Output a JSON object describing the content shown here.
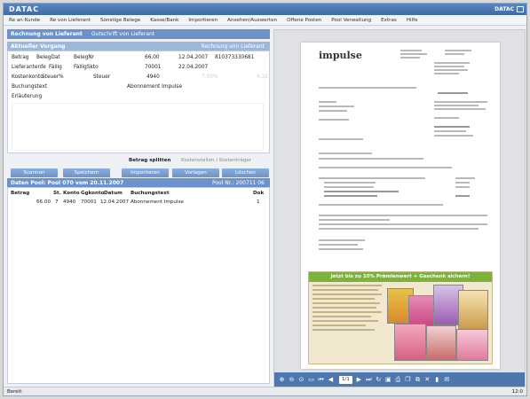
{
  "app": {
    "logo": "DATAC",
    "brand": "DATAC"
  },
  "menu": [
    "Re an Kunde",
    "Re von Lieferant",
    "Sonstige Belege",
    "Kasse/Bank",
    "Importieren",
    "Ansehen/Auswerten",
    "Offene Posten",
    "Pool Verwaltung",
    "Extras",
    "Hilfe"
  ],
  "section": {
    "title": "Rechnung von Lieferant",
    "subtitle": "Gutschrift von Lieferant"
  },
  "form_panel": {
    "title": "Aktueller Vorgang",
    "right": "Rechnung von Lieferant"
  },
  "form": {
    "row1": {
      "label1": "Betrag",
      "label2": "BelegDat",
      "label3": "BelegNr",
      "v1": "66.00",
      "v2": "12.04.2007",
      "v3": "810373330681"
    },
    "row2": {
      "label1": "Lieferantenfe",
      "label2": "Fällig",
      "label3": "FälligSkto",
      "v1": "70001",
      "v2": "22.04.2007"
    },
    "row3": {
      "label1": "Kostenkonto",
      "label2": "Steuer%",
      "label3": "Steuer",
      "v1": "4940",
      "v2": "7.00%",
      "v3": "4.32"
    },
    "row4": {
      "label1": "Buchungstext",
      "v1": "Abonnement Impulse"
    },
    "row5": {
      "label1": "Erläuterung"
    }
  },
  "checks": {
    "betrag_splitten": "Betrag splitten",
    "kostenstellen": "Kostenstellen / Kostenträger"
  },
  "buttons": [
    "Scannen",
    "Speichern",
    "Importieren",
    "Vorlagen",
    "Löschen"
  ],
  "table_panel": {
    "title": "Daten Pool: Pool 070 vom 20.11.2007",
    "right": "Pool Nr.: 200711 06"
  },
  "table": {
    "headers": [
      "Betrag",
      "St.",
      "Konto",
      "Ggkonto",
      "Datum",
      "Buchungstext",
      "Dok"
    ],
    "rows": [
      [
        "66.00",
        "7",
        "4940",
        "70001",
        "12.04.2007",
        "Abonnement Impulse",
        "1"
      ]
    ]
  },
  "status": {
    "left": "Bereit",
    "right": "12:0"
  },
  "viewer": {
    "doc_title": "impulse",
    "ad_banner": "Jetzt bis zu 10% Prämienwert + Geschenk sichern!",
    "page_label": "1/1"
  }
}
